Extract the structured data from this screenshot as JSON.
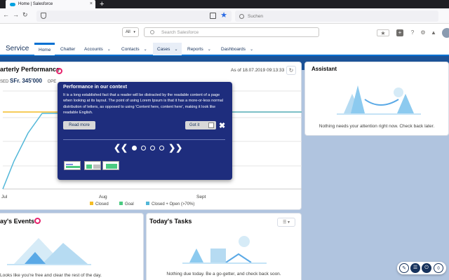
{
  "browser": {
    "tab_title": "Home | Salesforce",
    "tab_close": "×",
    "new_tab": "+",
    "search_placeholder": "Suchen"
  },
  "header": {
    "scope_select": "All",
    "search_placeholder": "Search Salesforce",
    "app_name": "Service"
  },
  "nav": {
    "tabs": [
      {
        "label": "Home",
        "chevron": ""
      },
      {
        "label": "Chatter",
        "chevron": ""
      },
      {
        "label": "Accounts",
        "chevron": "⌄"
      },
      {
        "label": "Contacts",
        "chevron": "⌄"
      },
      {
        "label": "Cases",
        "chevron": "⌄"
      },
      {
        "label": "Reports",
        "chevron": "⌄"
      },
      {
        "label": "Dashboards",
        "chevron": "⌄"
      }
    ]
  },
  "performance": {
    "title": "arterly Performance",
    "closed_label": "SED",
    "closed_value": "SFr. 345'000",
    "open_label": "OPE",
    "as_of": "As of 18.07.2019 09:13:33",
    "refresh_icon": "↻"
  },
  "chart_data": {
    "type": "line",
    "x_ticks": [
      "Jul",
      "Aug",
      "Sept"
    ],
    "legend": [
      "Closed",
      "Goal",
      "Closed + Open (>70%)"
    ],
    "colors": {
      "closed": "#f4bc25",
      "goal": "#4bca81",
      "closed_open": "#52b7d8"
    }
  },
  "assistant": {
    "title": "Assistant",
    "message": "Nothing needs your attention right now. Check back later."
  },
  "events": {
    "title": "ay's Events",
    "message": "Looks like you're free and clear the rest of the day."
  },
  "tasks": {
    "title": "Today's Tasks",
    "message": "Nothing due today. Be a go-getter, and check back soon."
  },
  "popover": {
    "title": "Performance in our context",
    "body": "It is a long established fact that a reader will be distracted by the readable content of a page when looking at its layout. The point of using Lorem Ipsum is that it has a more-or-less normal distribution of letters, as opposed to using 'Content here, content here', making it look like readable English.",
    "read_more": "Read more",
    "got_it": "Got it",
    "close": "✖",
    "prev": "❮❮",
    "next": "❯❯",
    "active_step": 1
  }
}
